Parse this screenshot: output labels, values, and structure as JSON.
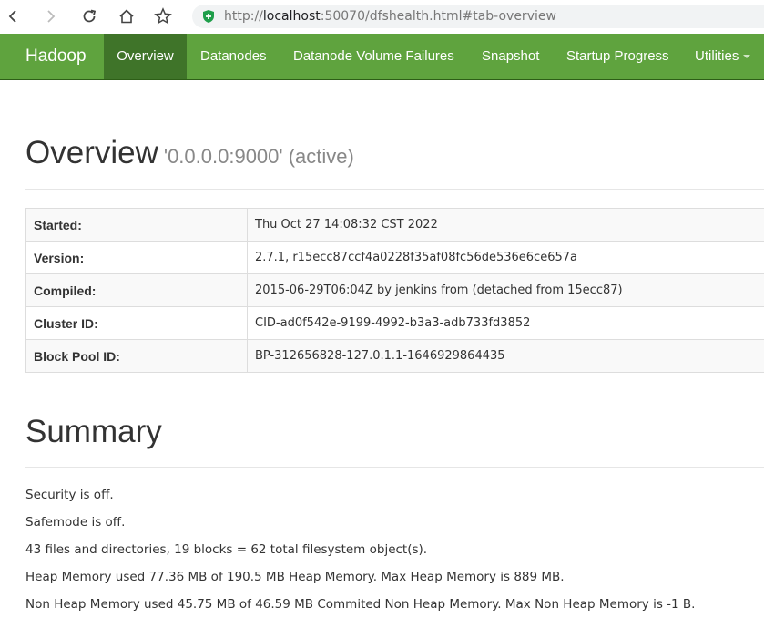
{
  "browser": {
    "url_prefix": "http://",
    "url_host": "localhost",
    "url_rest": ":50070/dfshealth.html#tab-overview"
  },
  "navbar": {
    "brand": "Hadoop",
    "items": [
      {
        "label": "Overview",
        "active": true
      },
      {
        "label": "Datanodes"
      },
      {
        "label": "Datanode Volume Failures"
      },
      {
        "label": "Snapshot"
      },
      {
        "label": "Startup Progress"
      },
      {
        "label": "Utilities"
      }
    ]
  },
  "overview": {
    "title": "Overview",
    "subtitle": "'0.0.0.0:9000' (active)",
    "rows": [
      {
        "key": "Started:",
        "value": "Thu Oct 27 14:08:32 CST 2022"
      },
      {
        "key": "Version:",
        "value": "2.7.1, r15ecc87ccf4a0228f35af08fc56de536e6ce657a"
      },
      {
        "key": "Compiled:",
        "value": "2015-06-29T06:04Z by jenkins from (detached from 15ecc87)"
      },
      {
        "key": "Cluster ID:",
        "value": "CID-ad0f542e-9199-4992-b3a3-adb733fd3852"
      },
      {
        "key": "Block Pool ID:",
        "value": "BP-312656828-127.0.1.1-1646929864435"
      }
    ]
  },
  "summary": {
    "title": "Summary",
    "lines": [
      "Security is off.",
      "Safemode is off.",
      "43 files and directories, 19 blocks = 62 total filesystem object(s).",
      "Heap Memory used 77.36 MB of 190.5 MB Heap Memory. Max Heap Memory is 889 MB.",
      "Non Heap Memory used 45.75 MB of 46.59 MB Commited Non Heap Memory. Max Non Heap Memory is -1 B."
    ]
  },
  "colors": {
    "navbar": "#5fa33e",
    "navbar_active": "#3f7429",
    "shield": "#1e9e4a"
  }
}
